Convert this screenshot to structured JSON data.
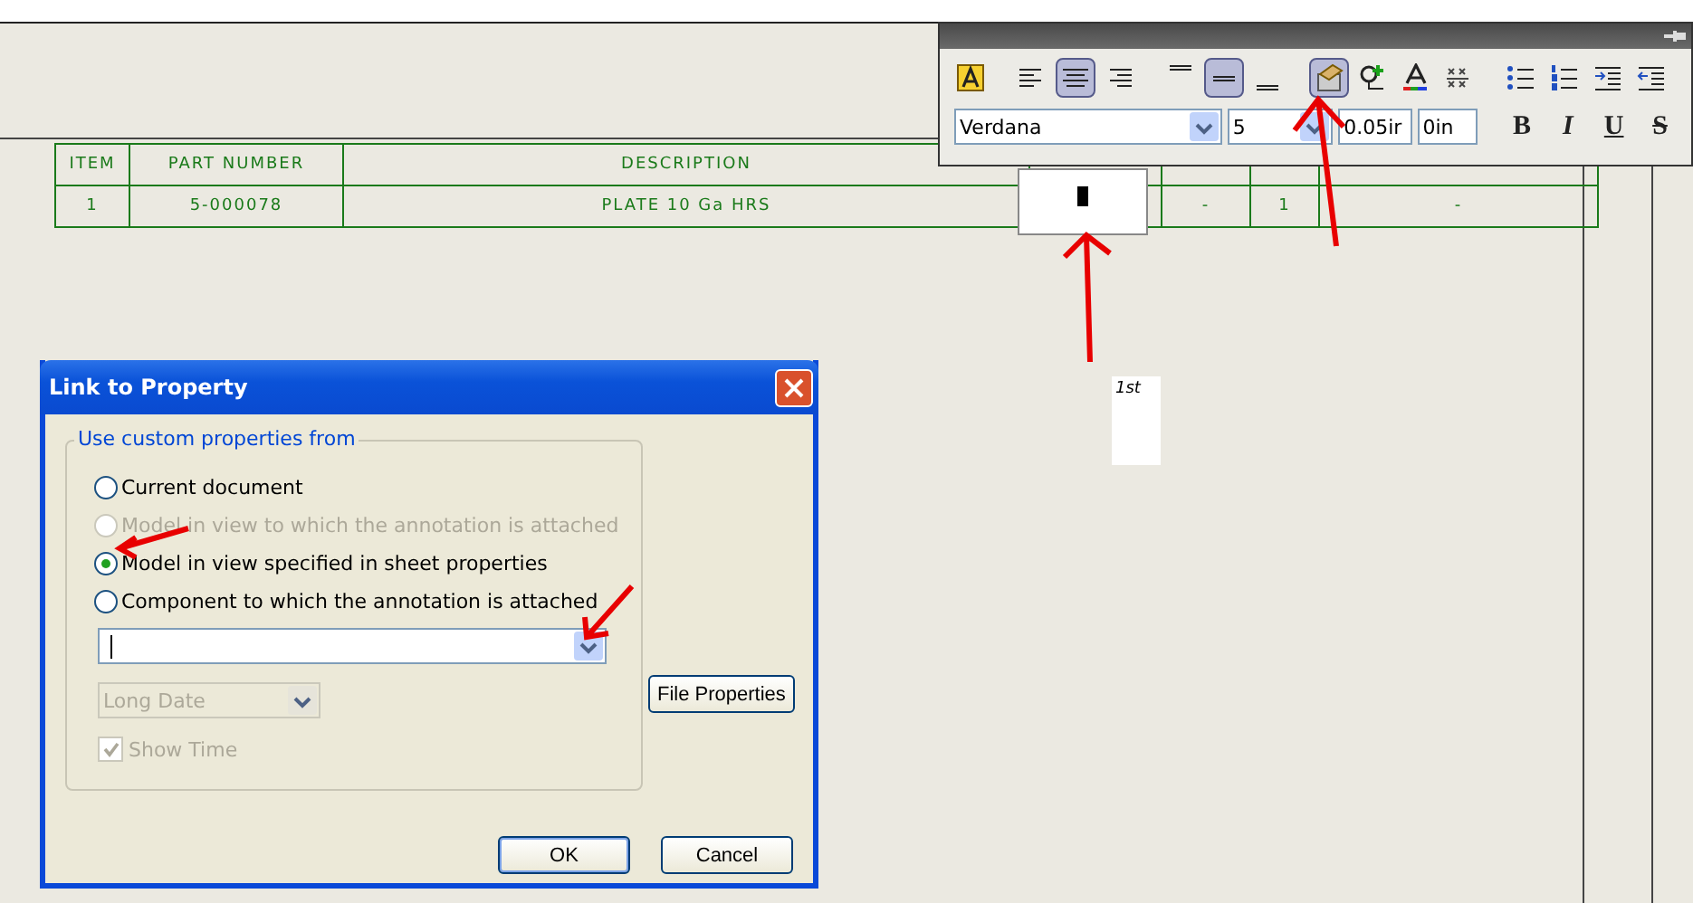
{
  "table": {
    "columns": [
      {
        "kind": "text",
        "label": "ITEM"
      },
      {
        "kind": "text",
        "label": "PART NUMBER"
      },
      {
        "kind": "text",
        "label": "DESCRIPTION"
      },
      {
        "kind": "covered"
      },
      {
        "kind": "covered"
      },
      {
        "kind": "covered"
      },
      {
        "kind": "covered"
      }
    ],
    "rows": [
      {
        "cells": [
          {
            "kind": "text",
            "text": "1"
          },
          {
            "kind": "text",
            "text": "5-000078"
          },
          {
            "kind": "text",
            "text": "PLATE 10 Ga HRS"
          },
          {
            "kind": "editor"
          },
          {
            "kind": "text",
            "text": "-"
          },
          {
            "kind": "text",
            "text": "1"
          },
          {
            "kind": "text",
            "text": "-"
          }
        ]
      }
    ]
  },
  "note": {
    "text": "1st"
  },
  "toolbar": {
    "buttons": [
      {
        "kind": "style",
        "selected": false
      },
      {
        "kind": "left",
        "selected": false
      },
      {
        "kind": "center",
        "selected": true
      },
      {
        "kind": "right",
        "selected": false
      },
      {
        "kind": "top",
        "selected": false
      },
      {
        "kind": "middle",
        "selected": true
      },
      {
        "kind": "bottom",
        "selected": false
      },
      {
        "kind": "link",
        "selected": true
      },
      {
        "kind": "balloon",
        "selected": false
      },
      {
        "kind": "color",
        "selected": false
      },
      {
        "kind": "stack",
        "selected": false
      },
      {
        "kind": "bullets",
        "selected": false
      },
      {
        "kind": "numbers",
        "selected": false
      },
      {
        "kind": "indent",
        "selected": false
      },
      {
        "kind": "outdent",
        "selected": false
      }
    ],
    "font": "Verdana",
    "size": "5",
    "spacing": "0.05ir",
    "offset": "0in",
    "styles": [
      {
        "kind": "bold",
        "label": "B"
      },
      {
        "kind": "italic",
        "label": "I"
      },
      {
        "kind": "underline",
        "label": "U"
      },
      {
        "kind": "strike",
        "label": "S"
      }
    ]
  },
  "dialog": {
    "title": "Link to Property",
    "group": "Use custom properties from",
    "options": [
      {
        "label": "Current document",
        "selected": false,
        "disabled": false
      },
      {
        "label": "Model in view to which the annotation is attached",
        "selected": false,
        "disabled": true
      },
      {
        "label": "Model in view specified in sheet properties",
        "selected": true,
        "disabled": false
      },
      {
        "label": "Component to which the annotation is attached",
        "selected": false,
        "disabled": false
      }
    ],
    "file_properties": "File Properties",
    "date_format": {
      "value": "Long Date",
      "disabled": true
    },
    "show_time": {
      "label": "Show Time",
      "checked": true,
      "disabled": true
    },
    "buttons": [
      {
        "label": "OK",
        "kind": "default"
      },
      {
        "label": "Cancel",
        "kind": "normal"
      }
    ]
  }
}
